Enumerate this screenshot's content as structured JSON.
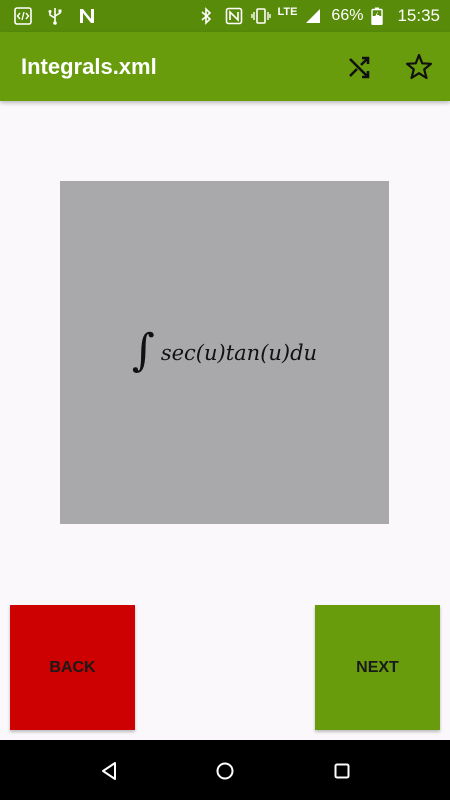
{
  "status_bar": {
    "left_icons": [
      "code-icon",
      "usb-icon",
      "n-app-icon"
    ],
    "right_icons": [
      "bluetooth-icon",
      "nfc-icon",
      "vibrate-icon",
      "signal-icon",
      "battery-icon"
    ],
    "network": "LTE",
    "battery": "66%",
    "time": "15:35"
  },
  "app_bar": {
    "title": "Integrals.xml",
    "actions": [
      "shuffle-icon",
      "star-icon"
    ]
  },
  "card": {
    "integral_symbol": "∫",
    "expression": "sec(u)tan(u)du"
  },
  "buttons": {
    "back": "BACK",
    "next": "NEXT"
  },
  "nav_bar": {
    "items": [
      "back-triangle-icon",
      "home-circle-icon",
      "recents-square-icon"
    ]
  },
  "colors": {
    "status_bar": "#588B0A",
    "app_bar": "#689C0D",
    "card": "#A9A8AB",
    "back_button": "#CD0101",
    "next_button": "#689C0D",
    "background": "#FAF8FB"
  }
}
